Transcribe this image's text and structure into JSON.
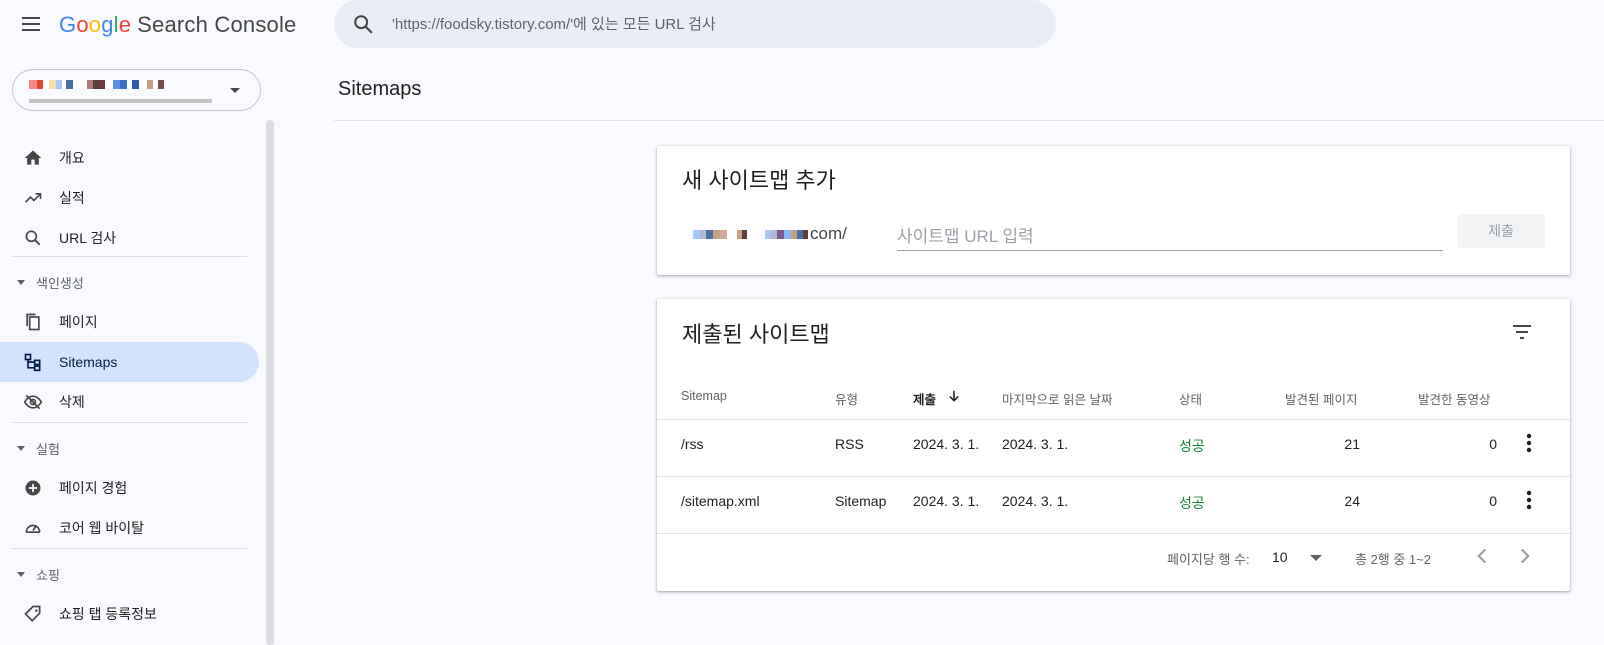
{
  "app": {
    "logo_letters": [
      "G",
      "o",
      "o",
      "g",
      "l",
      "e"
    ],
    "product_name": "Search Console"
  },
  "search": {
    "placeholder": "'https://foodsky.tistory.com/'에 있는 모든 URL 검사"
  },
  "sidebar": {
    "top_items": [
      {
        "label": "개요",
        "icon": "home-icon"
      },
      {
        "label": "실적",
        "icon": "trending-up-icon"
      },
      {
        "label": "URL 검사",
        "icon": "search-icon"
      }
    ],
    "sections": [
      {
        "label": "색인생성",
        "items": [
          {
            "label": "페이지",
            "icon": "pages-icon"
          },
          {
            "label": "Sitemaps",
            "icon": "sitemap-icon",
            "active": true
          },
          {
            "label": "삭제",
            "icon": "visibility-off-icon"
          }
        ]
      },
      {
        "label": "실험",
        "items": [
          {
            "label": "페이지 경험",
            "icon": "add-circle-icon"
          },
          {
            "label": "코어 웹 바이탈",
            "icon": "speed-gauge-icon"
          }
        ]
      },
      {
        "label": "쇼핑",
        "items": [
          {
            "label": "쇼핑 탭 등록정보",
            "icon": "tag-icon"
          }
        ]
      }
    ]
  },
  "page": {
    "title": "Sitemaps"
  },
  "add_card": {
    "title": "새 사이트맵 추가",
    "url_suffix": "com/",
    "input_placeholder": "사이트맵 URL 입력",
    "submit_label": "제출"
  },
  "submitted_card": {
    "title": "제출된 사이트맵",
    "columns": [
      "Sitemap",
      "유형",
      "제출",
      "마지막으로 읽은 날짜",
      "상태",
      "발견된 페이지",
      "발견한 동영상"
    ],
    "rows": [
      {
        "sitemap": "/rss",
        "type": "RSS",
        "submitted": "2024. 3. 1.",
        "last_read": "2024. 3. 1.",
        "status": "성공",
        "pages": "21",
        "videos": "0"
      },
      {
        "sitemap": "/sitemap.xml",
        "type": "Sitemap",
        "submitted": "2024. 3. 1.",
        "last_read": "2024. 3. 1.",
        "status": "성공",
        "pages": "24",
        "videos": "0"
      }
    ],
    "pagination": {
      "rows_per_page_label": "페이지당 행 수:",
      "rows_per_page": "10",
      "range": "총 2행 중 1~2"
    }
  },
  "colors": {
    "accent": "#d3e3fd",
    "success": "#188038",
    "search_bg": "#e9eef6"
  }
}
